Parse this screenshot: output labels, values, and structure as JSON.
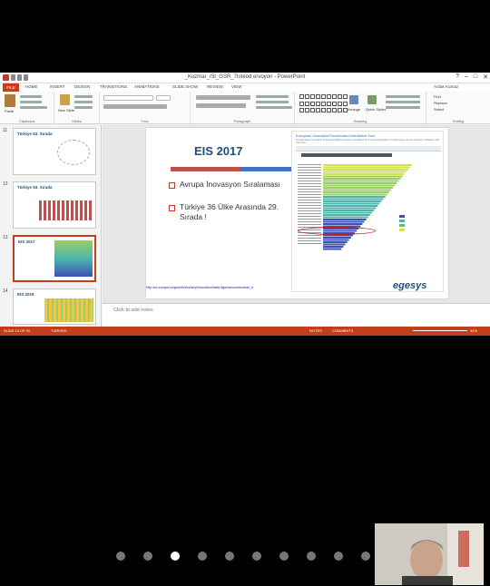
{
  "window": {
    "title": "_Kuzmar_r5t_GSR_7loteod ervoyon - PowerPoint"
  },
  "window_controls": [
    "?",
    "–",
    "□",
    "✕"
  ],
  "ribbon": {
    "tabs": [
      "FILE",
      "HOME",
      "INSERT",
      "DESIGN",
      "TRANSITIONS",
      "ANIMATIONS",
      "SLIDE SHOW",
      "REVIEW",
      "VIEW"
    ],
    "user": "Ardak Kurnaz",
    "groups": [
      "Clipboard",
      "Slides",
      "Font",
      "Paragraph",
      "Drawing",
      "Editing"
    ],
    "buttons": {
      "paste": "Paste",
      "new_slide": "New Slide",
      "arrange": "Arrange",
      "quick_styles": "Quick Styles",
      "find": "Find",
      "replace": "Replace",
      "select": "Select"
    }
  },
  "thumbnails": [
    {
      "number": "11",
      "title": "Türkiye 53. Sırada"
    },
    {
      "number": "12",
      "title": "Türkiye 53. Sırada"
    },
    {
      "number": "13",
      "title": "EIS 2017"
    },
    {
      "number": "14",
      "title": "EIS 2019"
    }
  ],
  "slide": {
    "title": "EIS 2017",
    "title_bar_colors": [
      "#c0504d",
      "#4472c4"
    ],
    "bullets": [
      "Avrupa İnovasyon Sıralaması",
      "Türkiye 36 Ülke Arasında 29. Sırada !"
    ],
    "screenshot_heading": "European Innovation Scoreboard Interactive Tool",
    "screenshot_text": "The European Innovation Scoreboard (EIS) interactive tool allows for a visual comparison of performance across countries, indicators and over time.",
    "url": "http://ec.europa.eu/growth/industry/innovation/facts-figures/scoreboards_tr",
    "logo": "egesys"
  },
  "notes": {
    "placeholder": "Click to add notes"
  },
  "status": {
    "slide_info": "SLIDE 13 OF 20",
    "language": "TURKISH",
    "notes_btn": "NOTES",
    "comments_btn": "COMMENTS",
    "zoom": "44%"
  },
  "pager": {
    "count": 10,
    "active": 2
  },
  "colors": {
    "accent": "#c43e1c",
    "slide_title": "#1f4e79"
  }
}
